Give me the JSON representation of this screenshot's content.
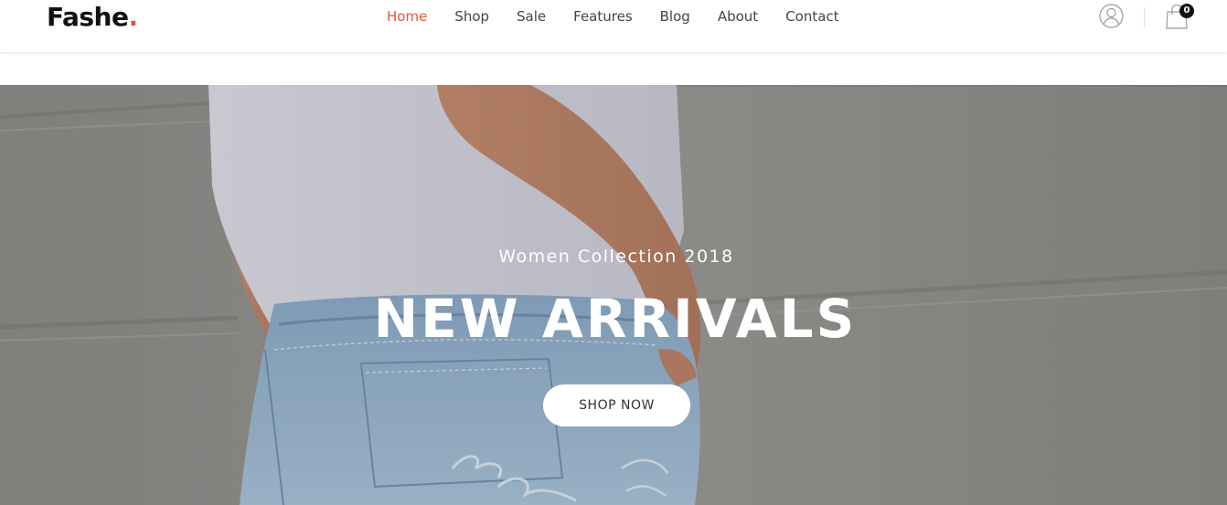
{
  "header": {
    "logo_text": "Fashe",
    "logo_dot": ".",
    "nav": [
      {
        "label": "Home",
        "active": true
      },
      {
        "label": "Shop",
        "active": false
      },
      {
        "label": "Sale",
        "active": false
      },
      {
        "label": "Features",
        "active": false
      },
      {
        "label": "Blog",
        "active": false
      },
      {
        "label": "About",
        "active": false
      },
      {
        "label": "Contact",
        "active": false
      }
    ],
    "user_icon": "user-circle-icon",
    "cart_icon": "shopping-bag-icon",
    "cart_count": "0"
  },
  "hero": {
    "subtitle": "Women Collection 2018",
    "title": "NEW ARRIVALS",
    "button_label": "SHOP NOW"
  },
  "colors": {
    "accent": "#e65540",
    "text": "#444444",
    "logo": "#111111",
    "button_bg": "#ffffff"
  }
}
